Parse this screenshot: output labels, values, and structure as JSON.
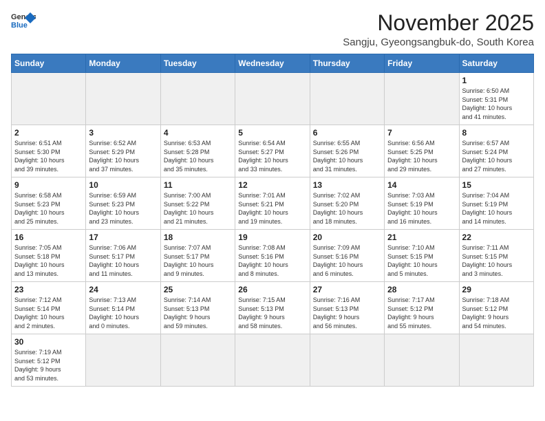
{
  "logo": {
    "line1": "General",
    "line2": "Blue"
  },
  "title": "November 2025",
  "location": "Sangju, Gyeongsangbuk-do, South Korea",
  "weekdays": [
    "Sunday",
    "Monday",
    "Tuesday",
    "Wednesday",
    "Thursday",
    "Friday",
    "Saturday"
  ],
  "days": [
    {
      "date": 1,
      "info": "Sunrise: 6:50 AM\nSunset: 5:31 PM\nDaylight: 10 hours\nand 41 minutes."
    },
    {
      "date": 2,
      "info": "Sunrise: 6:51 AM\nSunset: 5:30 PM\nDaylight: 10 hours\nand 39 minutes."
    },
    {
      "date": 3,
      "info": "Sunrise: 6:52 AM\nSunset: 5:29 PM\nDaylight: 10 hours\nand 37 minutes."
    },
    {
      "date": 4,
      "info": "Sunrise: 6:53 AM\nSunset: 5:28 PM\nDaylight: 10 hours\nand 35 minutes."
    },
    {
      "date": 5,
      "info": "Sunrise: 6:54 AM\nSunset: 5:27 PM\nDaylight: 10 hours\nand 33 minutes."
    },
    {
      "date": 6,
      "info": "Sunrise: 6:55 AM\nSunset: 5:26 PM\nDaylight: 10 hours\nand 31 minutes."
    },
    {
      "date": 7,
      "info": "Sunrise: 6:56 AM\nSunset: 5:25 PM\nDaylight: 10 hours\nand 29 minutes."
    },
    {
      "date": 8,
      "info": "Sunrise: 6:57 AM\nSunset: 5:24 PM\nDaylight: 10 hours\nand 27 minutes."
    },
    {
      "date": 9,
      "info": "Sunrise: 6:58 AM\nSunset: 5:23 PM\nDaylight: 10 hours\nand 25 minutes."
    },
    {
      "date": 10,
      "info": "Sunrise: 6:59 AM\nSunset: 5:23 PM\nDaylight: 10 hours\nand 23 minutes."
    },
    {
      "date": 11,
      "info": "Sunrise: 7:00 AM\nSunset: 5:22 PM\nDaylight: 10 hours\nand 21 minutes."
    },
    {
      "date": 12,
      "info": "Sunrise: 7:01 AM\nSunset: 5:21 PM\nDaylight: 10 hours\nand 19 minutes."
    },
    {
      "date": 13,
      "info": "Sunrise: 7:02 AM\nSunset: 5:20 PM\nDaylight: 10 hours\nand 18 minutes."
    },
    {
      "date": 14,
      "info": "Sunrise: 7:03 AM\nSunset: 5:19 PM\nDaylight: 10 hours\nand 16 minutes."
    },
    {
      "date": 15,
      "info": "Sunrise: 7:04 AM\nSunset: 5:19 PM\nDaylight: 10 hours\nand 14 minutes."
    },
    {
      "date": 16,
      "info": "Sunrise: 7:05 AM\nSunset: 5:18 PM\nDaylight: 10 hours\nand 13 minutes."
    },
    {
      "date": 17,
      "info": "Sunrise: 7:06 AM\nSunset: 5:17 PM\nDaylight: 10 hours\nand 11 minutes."
    },
    {
      "date": 18,
      "info": "Sunrise: 7:07 AM\nSunset: 5:17 PM\nDaylight: 10 hours\nand 9 minutes."
    },
    {
      "date": 19,
      "info": "Sunrise: 7:08 AM\nSunset: 5:16 PM\nDaylight: 10 hours\nand 8 minutes."
    },
    {
      "date": 20,
      "info": "Sunrise: 7:09 AM\nSunset: 5:16 PM\nDaylight: 10 hours\nand 6 minutes."
    },
    {
      "date": 21,
      "info": "Sunrise: 7:10 AM\nSunset: 5:15 PM\nDaylight: 10 hours\nand 5 minutes."
    },
    {
      "date": 22,
      "info": "Sunrise: 7:11 AM\nSunset: 5:15 PM\nDaylight: 10 hours\nand 3 minutes."
    },
    {
      "date": 23,
      "info": "Sunrise: 7:12 AM\nSunset: 5:14 PM\nDaylight: 10 hours\nand 2 minutes."
    },
    {
      "date": 24,
      "info": "Sunrise: 7:13 AM\nSunset: 5:14 PM\nDaylight: 10 hours\nand 0 minutes."
    },
    {
      "date": 25,
      "info": "Sunrise: 7:14 AM\nSunset: 5:13 PM\nDaylight: 9 hours\nand 59 minutes."
    },
    {
      "date": 26,
      "info": "Sunrise: 7:15 AM\nSunset: 5:13 PM\nDaylight: 9 hours\nand 58 minutes."
    },
    {
      "date": 27,
      "info": "Sunrise: 7:16 AM\nSunset: 5:13 PM\nDaylight: 9 hours\nand 56 minutes."
    },
    {
      "date": 28,
      "info": "Sunrise: 7:17 AM\nSunset: 5:12 PM\nDaylight: 9 hours\nand 55 minutes."
    },
    {
      "date": 29,
      "info": "Sunrise: 7:18 AM\nSunset: 5:12 PM\nDaylight: 9 hours\nand 54 minutes."
    },
    {
      "date": 30,
      "info": "Sunrise: 7:19 AM\nSunset: 5:12 PM\nDaylight: 9 hours\nand 53 minutes."
    }
  ]
}
